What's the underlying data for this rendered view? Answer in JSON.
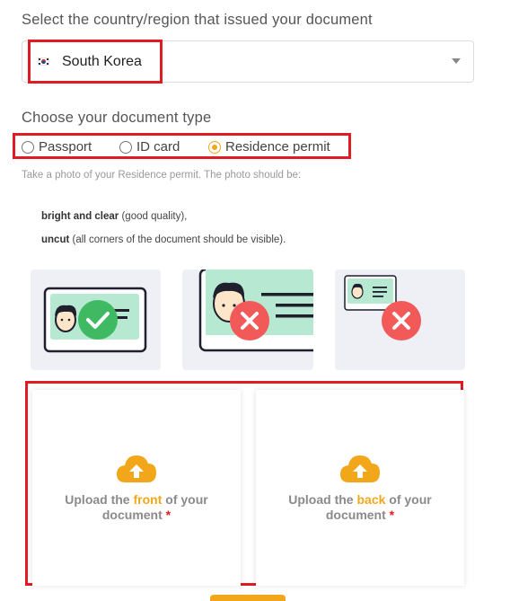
{
  "country": {
    "label": "Select the country/region that issued your document",
    "selected": "South Korea"
  },
  "document_type": {
    "label": "Choose your document type",
    "options": [
      {
        "label": "Passport",
        "checked": false
      },
      {
        "label": "ID card",
        "checked": false
      },
      {
        "label": "Residence permit",
        "checked": true
      }
    ]
  },
  "instructions": {
    "intro": "Take a photo of your Residence permit. The photo should be:",
    "q1_bold": "bright and clear",
    "q1_rest": " (good quality),",
    "q2_bold": "uncut",
    "q2_rest": " (all corners of the document should be visible)."
  },
  "examples": [
    {
      "name": "correct-example",
      "status": "check-icon"
    },
    {
      "name": "cropped-example",
      "status": "cross-icon"
    },
    {
      "name": "too-small-example",
      "status": "cross-icon"
    }
  ],
  "upload": {
    "front": {
      "pre": "Upload the ",
      "accent": "front",
      "post": " of your",
      "line2": "document",
      "required": "*"
    },
    "back": {
      "pre": "Upload the ",
      "accent": "back",
      "post": " of your",
      "line2": "document",
      "required": "*"
    }
  },
  "colors": {
    "accent": "#f2a71b",
    "highlight": "#e01b23",
    "card_mint": "#b6e8d2",
    "ok_green": "#3fba63",
    "error_red": "#f25a5a"
  }
}
